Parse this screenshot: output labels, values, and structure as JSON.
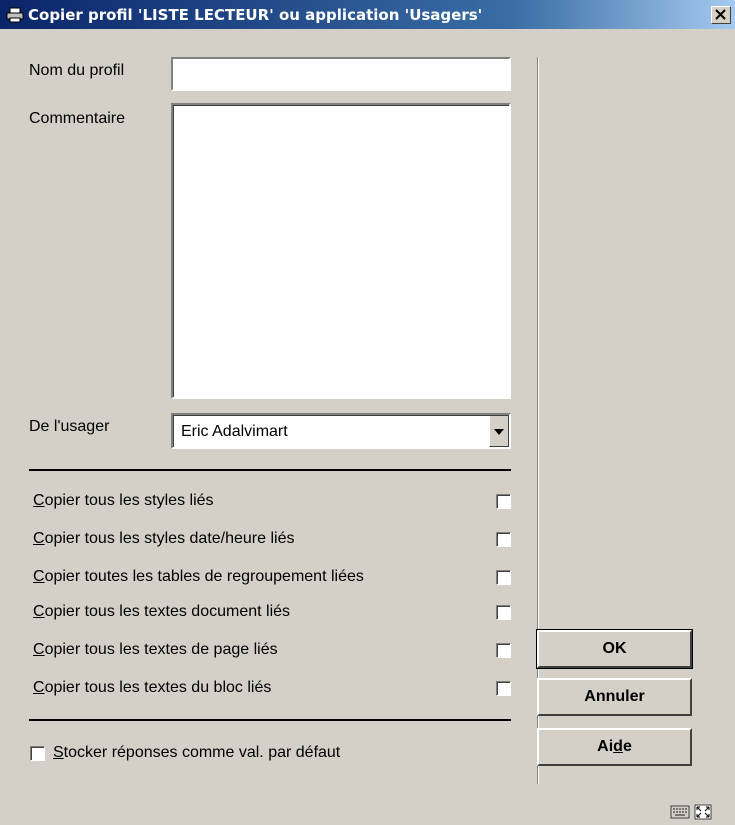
{
  "window": {
    "title": "Copier profil 'LISTE LECTEUR' ou application 'Usagers'",
    "close_glyph": "×"
  },
  "form": {
    "profile_name_label": "Nom du profil",
    "profile_name_value": "",
    "comment_label": "Commentaire",
    "comment_value": "",
    "user_label": "De l'usager",
    "user_selected": "Eric Adalvimart"
  },
  "copy_options": [
    {
      "key": "C",
      "rest": "opier tous les styles liés",
      "checked": false
    },
    {
      "key": "C",
      "rest": "opier tous les styles date/heure liés",
      "checked": false
    },
    {
      "key": "C",
      "rest": "opier toutes les tables de regroupement liées",
      "checked": false
    },
    {
      "key": "C",
      "rest": "opier tous les textes document liés",
      "checked": false
    },
    {
      "key": "C",
      "rest": "opier tous les textes de page liés",
      "checked": false
    },
    {
      "key": "C",
      "rest": "opier tous les textes du bloc liés",
      "checked": false
    }
  ],
  "store_default": {
    "key": "S",
    "rest": "tocker réponses comme val. par défaut",
    "checked": false
  },
  "buttons": {
    "ok": "OK",
    "cancel": "Annuler",
    "help_pre": "Ai",
    "help_key": "d",
    "help_post": "e"
  },
  "status_icons": [
    "keyboard-icon",
    "resize-icon"
  ],
  "colors": {
    "face": "#d4d0c8",
    "title_start": "#0a246a",
    "title_end": "#a6caf0"
  }
}
